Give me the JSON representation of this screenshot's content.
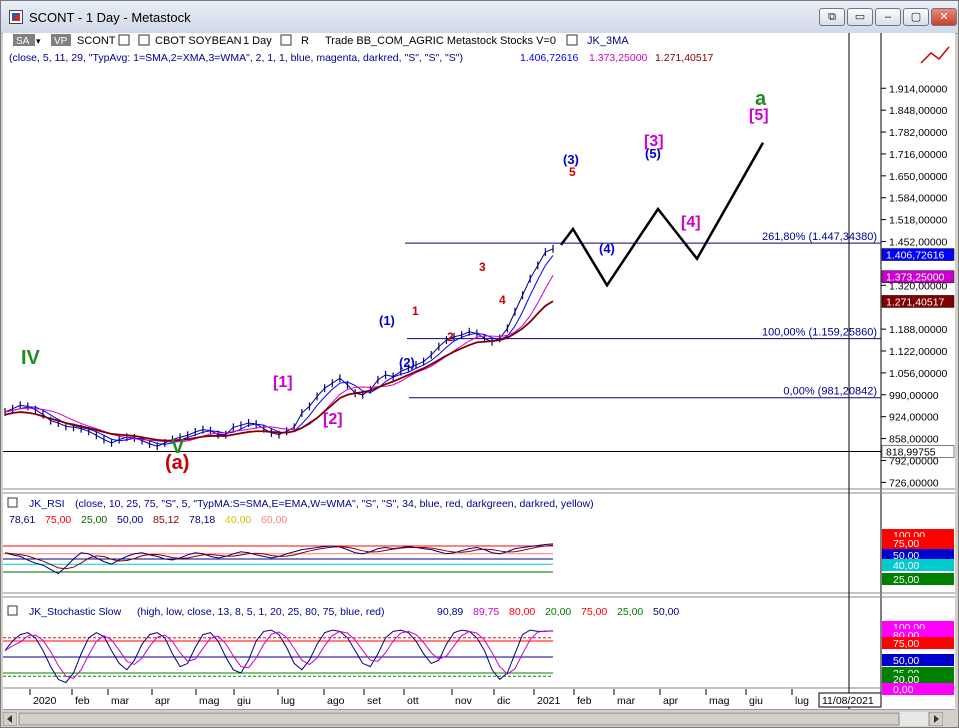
{
  "window": {
    "title": "SCONT - 1 Day - Metastock",
    "buttons": [
      "⧉",
      "▭",
      "–",
      "▢",
      "✕"
    ]
  },
  "toolbar": {
    "sa": "SA",
    "vp": "VP",
    "symbol": "SCONT",
    "security": "CBOT SOYBEAN",
    "period": "1 Day",
    "r": "R",
    "info": "Trade  BB_COM_AGRIC  Metastock  Stocks  V=0",
    "jk3ma": "JK_3MA",
    "params": "(close,  5,  11,  29,  \"TypAvg: 1=SMA,2=XMA,3=WMA\",  2,  1,  1,  blue,  magenta,  darkred,  \"S\",  \"S\",  \"S\")",
    "v1": "1.406,72616",
    "v2": "1.373,25000",
    "v3": "1.271,40517"
  },
  "colors": {
    "price": "#000080",
    "ma_fast": "#0000ff",
    "ma_mid": "#cc00cc",
    "ma_slow": "#800000",
    "wave_black": "#000000",
    "wave_green": "#228b22",
    "wave_red": "#cc0000",
    "wave_blue": "#0000cc",
    "wave_magenta": "#cc00cc"
  },
  "chart_data": [
    {
      "type": "line",
      "panel": "price",
      "yaxis": {
        "min": 700,
        "max": 1960,
        "ticks": [
          "1.914,00000",
          "1.848,00000",
          "1.782,00000",
          "1.716,00000",
          "1.650,00000",
          "1.584,00000",
          "1.518,00000",
          "1.452,00000",
          "1.320,00000",
          "1.188,00000",
          "1.122,00000",
          "1.056,00000",
          "990,00000",
          "924,00000",
          "858,00000",
          "792,00000",
          "726,00000"
        ],
        "tick_values": [
          1914,
          1848,
          1782,
          1716,
          1650,
          1584,
          1518,
          1452,
          1320,
          1188,
          1122,
          1056,
          990,
          924,
          858,
          792,
          726
        ]
      },
      "value_boxes": [
        {
          "label": "1.406,72616",
          "value": 1406.7,
          "color": "#0000ff"
        },
        {
          "label": "1.373,25000",
          "value": 1373.25,
          "color": "#cc00cc"
        },
        {
          "label": "1.271,40517",
          "value": 1271.4,
          "color": "#800000"
        },
        {
          "label": "818,99755",
          "value": 819,
          "color": "#ffffff"
        }
      ],
      "x_labels": [
        "2020",
        "feb",
        "mar",
        "apr",
        "mag",
        "giu",
        "lug",
        "ago",
        "set",
        "ott",
        "nov",
        "dic",
        "2021",
        "feb",
        "mar",
        "apr",
        "mag",
        "giu",
        "lug"
      ],
      "date_box": "11/08/2021",
      "price_series": [
        938,
        948,
        958,
        955,
        945,
        930,
        912,
        905,
        895,
        892,
        888,
        880,
        868,
        855,
        845,
        855,
        862,
        860,
        852,
        842,
        835,
        845,
        855,
        862,
        868,
        878,
        885,
        882,
        870,
        870,
        892,
        898,
        905,
        902,
        888,
        875,
        870,
        880,
        892,
        935,
        955,
        985,
        1010,
        1025,
        1040,
        1020,
        995,
        990,
        1005,
        1035,
        1050,
        1045,
        1060,
        1070,
        1080,
        1090,
        1110,
        1135,
        1155,
        1165,
        1170,
        1180,
        1175,
        1160,
        1150,
        1160,
        1190,
        1240,
        1290,
        1340,
        1380,
        1420,
        1430
      ],
      "ma_slow_series": [
        930,
        935,
        938,
        936,
        932,
        925,
        918,
        912,
        905,
        900,
        895,
        890,
        884,
        878,
        872,
        870,
        868,
        866,
        862,
        858,
        854,
        852,
        852,
        854,
        856,
        860,
        864,
        866,
        866,
        866,
        870,
        874,
        878,
        880,
        880,
        878,
        876,
        876,
        880,
        890,
        905,
        920,
        940,
        960,
        980,
        990,
        995,
        998,
        1003,
        1012,
        1022,
        1030,
        1040,
        1050,
        1060,
        1070,
        1082,
        1095,
        1108,
        1120,
        1130,
        1140,
        1148,
        1150,
        1152,
        1155,
        1162,
        1175,
        1190,
        1210,
        1235,
        1258,
        1272
      ],
      "fib_levels": [
        {
          "label": "261,80% (1.447,34380)",
          "value": 1447.3
        },
        {
          "label": "100,00% (1.159,25860)",
          "value": 1159.3
        },
        {
          "label": "0,00% (981,20842)",
          "value": 981.2
        }
      ],
      "projection": [
        {
          "label": "(3)",
          "value": 1490
        },
        {
          "label": "(4)",
          "value": 1320
        },
        {
          "label": "(5)",
          "value": 1550
        },
        {
          "label": "[4]",
          "value": 1400
        },
        {
          "label": "[5]",
          "value": 1750
        }
      ],
      "wave_labels": [
        "IV",
        "V",
        "(a)",
        "[1]",
        "[2]",
        "(1)",
        "(2)",
        "1",
        "2",
        "3",
        "4",
        "5",
        "(3)",
        "(4)",
        "(5)",
        "[3]",
        "[4]",
        "[5]",
        "a"
      ]
    },
    {
      "type": "line",
      "panel": "rsi",
      "title": "JK_RSI",
      "params": "(close,  10,  25,  75,  \"S\",  5,  \"TypMA:S=SMA,E=EMA,W=WMA\",  \"S\",  \"S\",  34,  blue,  red,  darkgreen,  darkred,  yellow)",
      "values_text": [
        "78,61",
        "75,00",
        "25,00",
        "50,00",
        "85,12",
        "78,18",
        "40,00",
        "60,00"
      ],
      "values_colors": [
        "#000080",
        "#ff0000",
        "#006400",
        "#000080",
        "#8b0000",
        "#000080",
        "#cccc00",
        "#ff8080"
      ],
      "axis_boxes": [
        {
          "label": "100,00",
          "value": 100,
          "bg": "#ff0000",
          "fg": "#ffffff"
        },
        {
          "label": "75,00",
          "value": 75,
          "bg": "#ff0000",
          "fg": "#ffffff"
        },
        {
          "label": "50,00",
          "value": 50,
          "bg": "#0000cc",
          "fg": "#ffffff"
        },
        {
          "label": "40,00",
          "value": 40,
          "bg": "#00cccc",
          "fg": "#ffffff"
        },
        {
          "label": "25,00",
          "value": 25,
          "bg": "#008000",
          "fg": "#ffffff"
        }
      ],
      "series": [
        62,
        58,
        55,
        48,
        42,
        38,
        30,
        22,
        35,
        50,
        62,
        60,
        52,
        45,
        40,
        48,
        55,
        60,
        62,
        58,
        55,
        50,
        48,
        52,
        58,
        62,
        60,
        55,
        52,
        55,
        60,
        64,
        62,
        58,
        55,
        52,
        55,
        60,
        64,
        68,
        70,
        72,
        74,
        75,
        73,
        68,
        62,
        60,
        64,
        70,
        72,
        70,
        72,
        74,
        72,
        70,
        68,
        64,
        60,
        62,
        66,
        70,
        72,
        68,
        62,
        60,
        64,
        70,
        72,
        74,
        76,
        78,
        79
      ]
    },
    {
      "type": "line",
      "panel": "stochastic",
      "title": "JK_Stochastic Slow",
      "params": "(high,  low,  close,  13,  8,  5,  1,  20,  25,  80,  75,  blue,  red)",
      "values_text": [
        "90,89",
        "89,75",
        "80,00",
        "20,00",
        "75,00",
        "25,00",
        "50,00"
      ],
      "values_colors": [
        "#000080",
        "#cc00cc",
        "#ff0000",
        "#008000",
        "#ff0000",
        "#008000",
        "#000080"
      ],
      "axis_boxes": [
        {
          "label": "100,00",
          "value": 100,
          "bg": "#ff00ff",
          "fg": "#ffffff"
        },
        {
          "label": "80,00",
          "value": 80,
          "bg": "#ff00ff",
          "fg": "#ffffff"
        },
        {
          "label": "75,00",
          "value": 75,
          "bg": "#ff0000",
          "fg": "#ffffff"
        },
        {
          "label": "50,00",
          "value": 50,
          "bg": "#0000cc",
          "fg": "#ffffff"
        },
        {
          "label": "25,00",
          "value": 25,
          "bg": "#008000",
          "fg": "#ffffff"
        },
        {
          "label": "20,00",
          "value": 20,
          "bg": "#008000",
          "fg": "#ffffff"
        },
        {
          "label": "0,00",
          "value": 0,
          "bg": "#ff00ff",
          "fg": "#ffffff"
        }
      ],
      "series": [
        60,
        75,
        85,
        88,
        80,
        60,
        35,
        15,
        10,
        25,
        55,
        80,
        88,
        82,
        60,
        40,
        30,
        45,
        70,
        85,
        88,
        80,
        55,
        35,
        40,
        65,
        85,
        88,
        75,
        50,
        30,
        25,
        45,
        75,
        90,
        92,
        85,
        65,
        40,
        30,
        45,
        70,
        88,
        92,
        90,
        80,
        60,
        40,
        35,
        55,
        80,
        90,
        92,
        88,
        75,
        55,
        40,
        45,
        70,
        88,
        92,
        90,
        80,
        60,
        30,
        15,
        25,
        55,
        85,
        92,
        90,
        90,
        91
      ]
    }
  ]
}
